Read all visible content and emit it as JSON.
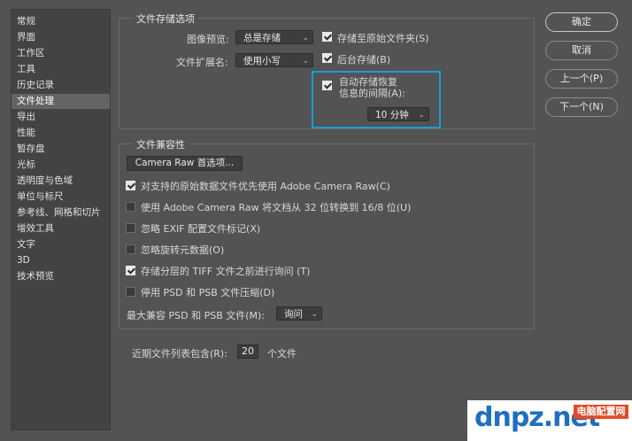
{
  "sidebar": {
    "items": [
      {
        "label": "常规"
      },
      {
        "label": "界面"
      },
      {
        "label": "工作区"
      },
      {
        "label": "工具"
      },
      {
        "label": "历史记录"
      },
      {
        "label": "文件处理"
      },
      {
        "label": "导出"
      },
      {
        "label": "性能"
      },
      {
        "label": "暂存盘"
      },
      {
        "label": "光标"
      },
      {
        "label": "透明度与色域"
      },
      {
        "label": "单位与标尺"
      },
      {
        "label": "参考线、网格和切片"
      },
      {
        "label": "增效工具"
      },
      {
        "label": "文字"
      },
      {
        "label": "3D"
      },
      {
        "label": "技术预览"
      }
    ],
    "selected": "文件处理"
  },
  "file_saving": {
    "title": "文件存储选项",
    "image_preview_label": "图像预览:",
    "image_preview_value": "总是存储",
    "extension_label": "文件扩展名:",
    "extension_value": "使用小写",
    "save_to_original_label": "存储至原始文件夹(S)",
    "save_to_original_checked": true,
    "background_save_label": "后台存储(B)",
    "background_save_checked": true,
    "auto_recovery_line1": "自动存储恢复",
    "auto_recovery_line2": "信息的间隔(A):",
    "auto_recovery_checked": true,
    "auto_recovery_value": "10 分钟"
  },
  "compatibility": {
    "title": "文件兼容性",
    "camera_raw_button": "Camera Raw 首选项...",
    "options": [
      {
        "label": "对支持的原始数据文件优先使用 Adobe Camera Raw(C)",
        "checked": true
      },
      {
        "label": "使用 Adobe Camera Raw 将文档从 32 位转换到 16/8 位(U)",
        "checked": false
      },
      {
        "label": "忽略 EXIF 配置文件标记(X)",
        "checked": false
      },
      {
        "label": "忽略旋转元数据(O)",
        "checked": false
      },
      {
        "label": "存储分层的 TIFF 文件之前进行询问 (T)",
        "checked": true
      },
      {
        "label": "停用 PSD 和 PSB 文件压缩(D)",
        "checked": false
      }
    ],
    "maximize_label": "最大兼容 PSD 和 PSB 文件(M):",
    "maximize_value": "询问"
  },
  "recent_files": {
    "label": "近期文件列表包含(R):",
    "value": "20",
    "suffix": "个文件"
  },
  "buttons": {
    "ok": "确定",
    "cancel": "取消",
    "prev": "上一个(P)",
    "next": "下一个(N)"
  },
  "colors": {
    "background": "#535353",
    "highlight_border": "#1d9bd8"
  },
  "watermark": {
    "text": "dnpz.net",
    "subtext": "电脑配置网"
  }
}
